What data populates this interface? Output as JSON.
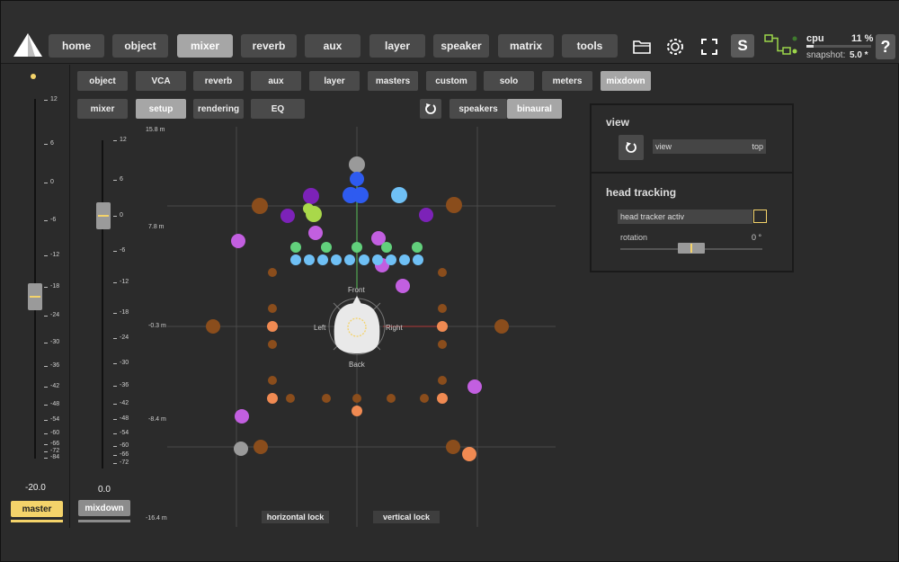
{
  "app": {
    "topnav": [
      "home",
      "object",
      "mixer",
      "reverb",
      "aux",
      "layer",
      "speaker",
      "matrix",
      "tools"
    ],
    "active_nav": "mixer",
    "cpu_label": "cpu",
    "cpu_value": "11 %",
    "cpu_fraction": 0.11,
    "snapshot_label": "snapshot:",
    "snapshot_value": "5.0 *",
    "solo_label": "S",
    "help_label": "?"
  },
  "master_strip": {
    "scale": [
      "12",
      "6",
      "0",
      "-6",
      "-12",
      "-18",
      "-24",
      "-30",
      "-36",
      "-42",
      "-48",
      "-54",
      "-60",
      "-66",
      "-72",
      "-84"
    ],
    "value": "-20.0",
    "button": "master"
  },
  "mixdown_strip": {
    "scale": [
      "12",
      "6",
      "0",
      "-6",
      "-12",
      "-18",
      "-24",
      "-30",
      "-36",
      "-42",
      "-48",
      "-54",
      "-60",
      "-66",
      "-72"
    ],
    "value": "0.0",
    "button": "mixdown"
  },
  "subtabs": {
    "row1": [
      "object",
      "VCA",
      "reverb",
      "aux",
      "layer",
      "masters",
      "custom",
      "solo",
      "meters",
      "mixdown"
    ],
    "row1_active": "mixdown",
    "row2": [
      "mixer",
      "setup",
      "rendering",
      "EQ"
    ],
    "row2_active": "setup",
    "mode": [
      "speakers",
      "binaural"
    ],
    "mode_active": "binaural"
  },
  "panner": {
    "y_labels": [
      "15.8 m",
      "7.8 m",
      "-0.3 m",
      "-8.4 m",
      "-16.4 m"
    ],
    "head_labels": {
      "front": "Front",
      "back": "Back",
      "left": "Left",
      "right": "Right"
    },
    "horizontal_lock": "horizontal lock",
    "vertical_lock": "vertical lock",
    "colors": {
      "brown": "#8a4d1c",
      "orange": "#f08a52",
      "magenta": "#c25fe0",
      "purple": "#7c22b8",
      "blue": "#2e5bf0",
      "lightblue": "#6fc0f5",
      "green": "#62d07c",
      "lime": "#a9d84a",
      "gray": "#9a9a9a"
    }
  },
  "view_panel": {
    "title": "view",
    "field_label": "view",
    "field_value": "top"
  },
  "head_panel": {
    "title": "head tracking",
    "toggle_label": "head tracker activ",
    "rotation_label": "rotation",
    "rotation_value": "0 °"
  }
}
